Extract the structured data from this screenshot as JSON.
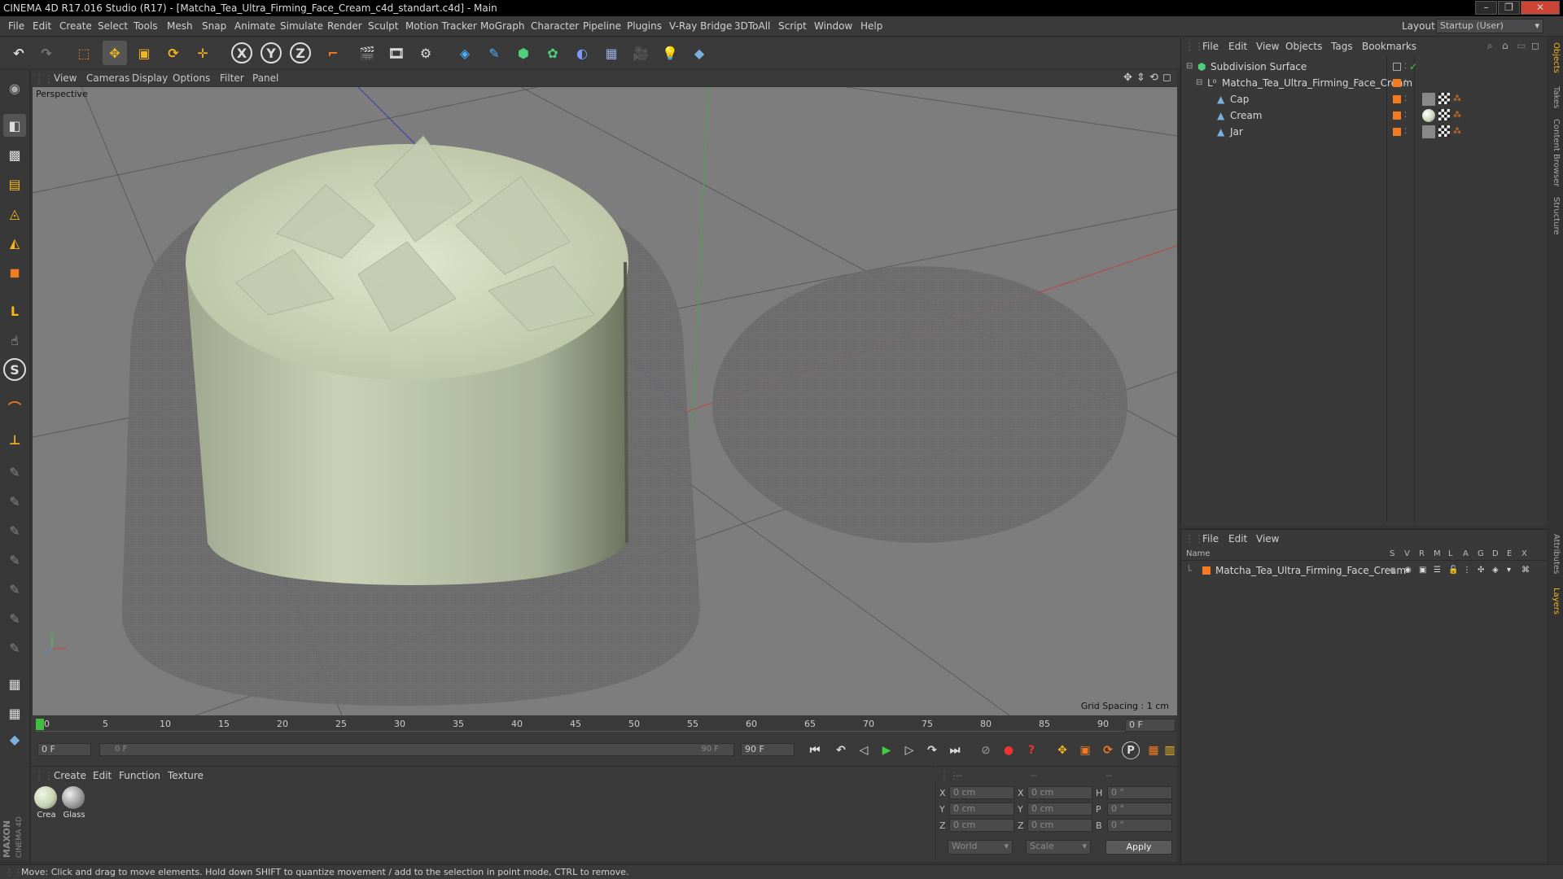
{
  "window": {
    "title": "CINEMA 4D R17.016 Studio (R17) - [Matcha_Tea_Ultra_Firming_Face_Cream_c4d_standart.c4d] - Main",
    "layout_label": "Layout:",
    "layout_value": "Startup (User)"
  },
  "menu": [
    "File",
    "Edit",
    "Create",
    "Select",
    "Tools",
    "Mesh",
    "Snap",
    "Animate",
    "Simulate",
    "Render",
    "Sculpt",
    "Motion Tracker",
    "MoGraph",
    "Character",
    "Pipeline",
    "Plugins",
    "V-Ray Bridge",
    "3DToAll",
    "Script",
    "Window",
    "Help"
  ],
  "viewport": {
    "menu": [
      "View",
      "Cameras",
      "Display",
      "Options",
      "Filter",
      "Panel"
    ],
    "label": "Perspective",
    "grid_spacing": "Grid Spacing : 1 cm"
  },
  "timeline": {
    "ticks": [
      "0",
      "5",
      "10",
      "15",
      "20",
      "25",
      "30",
      "35",
      "40",
      "45",
      "50",
      "55",
      "60",
      "65",
      "70",
      "75",
      "80",
      "85",
      "90"
    ],
    "frame_end_field": "0 F",
    "start_field": "0 F",
    "range_start": "0 F",
    "range_end": "90 F",
    "end_field": "90 F"
  },
  "materials": {
    "menu": [
      "Create",
      "Edit",
      "Function",
      "Texture"
    ],
    "items": [
      {
        "name": "Crea",
        "color": "#c8d3b4"
      },
      {
        "name": "Glass",
        "color": "#9a9a9a"
      }
    ]
  },
  "coords": {
    "headers": [
      "--",
      "--",
      "--"
    ],
    "rows": [
      {
        "a": "X",
        "av": "0 cm",
        "b": "X",
        "bv": "0 cm",
        "c": "H",
        "cv": "0 °"
      },
      {
        "a": "Y",
        "av": "0 cm",
        "b": "Y",
        "bv": "0 cm",
        "c": "P",
        "cv": "0 °"
      },
      {
        "a": "Z",
        "av": "0 cm",
        "b": "Z",
        "bv": "0 cm",
        "c": "B",
        "cv": "0 °"
      }
    ],
    "world": "World",
    "scale": "Scale",
    "apply": "Apply"
  },
  "objects": {
    "menu": [
      "File",
      "Edit",
      "View",
      "Objects",
      "Tags",
      "Bookmarks"
    ],
    "tree": [
      {
        "name": "Subdivision Surface",
        "icon": "subdivision-icon"
      },
      {
        "name": "Matcha_Tea_Ultra_Firming_Face_Cream",
        "icon": "null-icon"
      },
      {
        "name": "Cap",
        "icon": "polygon-icon"
      },
      {
        "name": "Cream",
        "icon": "polygon-icon"
      },
      {
        "name": "Jar",
        "icon": "polygon-icon"
      }
    ]
  },
  "layers": {
    "menu": [
      "File",
      "Edit",
      "View"
    ],
    "columns": [
      "Name",
      "S",
      "V",
      "R",
      "M",
      "L",
      "A",
      "G",
      "D",
      "E",
      "X"
    ],
    "rows": [
      {
        "name": "Matcha_Tea_Ultra_Firming_Face_Cream"
      }
    ]
  },
  "side_tabs": [
    "Objects",
    "Takes",
    "Content Browser",
    "Structure",
    "Attributes",
    "Layers"
  ],
  "status": "Move: Click and drag to move elements. Hold down SHIFT to quantize movement / add to the selection in point mode, CTRL to remove.",
  "brand": "MAXON CINEMA 4D",
  "colors": {
    "accent": "#f47a1f",
    "cream": "#c8d3b4",
    "viewport_bg": "#7d7d7d"
  }
}
